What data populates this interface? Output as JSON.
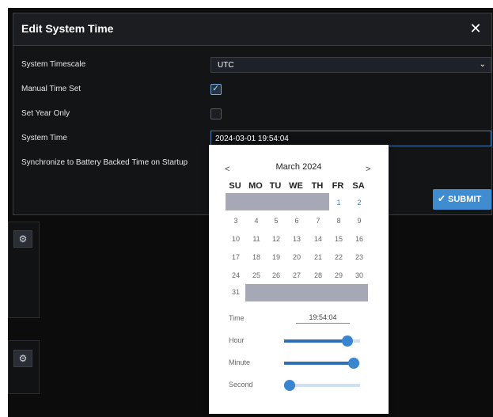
{
  "modal": {
    "title": "Edit System Time",
    "close_label": "✕",
    "fields": [
      {
        "label": "System Timescale"
      },
      {
        "label": "Manual Time Set"
      },
      {
        "label": "Set Year Only"
      },
      {
        "label": "System Time"
      },
      {
        "label": "Synchronize to Battery Backed Time on Startup"
      }
    ],
    "timescale_value": "UTC",
    "manual_time_checked": true,
    "set_year_only_checked": false,
    "system_time_value": "2024-03-01 19:54:04",
    "submit_label": "SUBMIT",
    "accent_color": "#3f8cd0"
  },
  "datepicker": {
    "prev": "<",
    "next": ">",
    "month_label": "March 2024",
    "weekdays": [
      "SU",
      "MO",
      "TU",
      "WE",
      "TH",
      "FR",
      "SA"
    ],
    "weeks": [
      [
        "",
        "",
        "",
        "",
        "",
        "1",
        "2"
      ],
      [
        "3",
        "4",
        "5",
        "6",
        "7",
        "8",
        "9"
      ],
      [
        "10",
        "11",
        "12",
        "13",
        "14",
        "15",
        "16"
      ],
      [
        "17",
        "18",
        "19",
        "20",
        "21",
        "22",
        "23"
      ],
      [
        "24",
        "25",
        "26",
        "27",
        "28",
        "29",
        "30"
      ],
      [
        "31",
        "",
        "",
        "",
        "",
        "",
        ""
      ]
    ],
    "selected_day": "1",
    "time_label": "Time",
    "time_value": "19:54:04",
    "sliders": [
      {
        "label": "Hour",
        "fraction": 0.83
      },
      {
        "label": "Minute",
        "fraction": 0.92
      },
      {
        "label": "Second",
        "fraction": 0.07
      }
    ]
  },
  "icons": {
    "gear": "⚙",
    "check": "✔",
    "chevron": "⌄"
  }
}
